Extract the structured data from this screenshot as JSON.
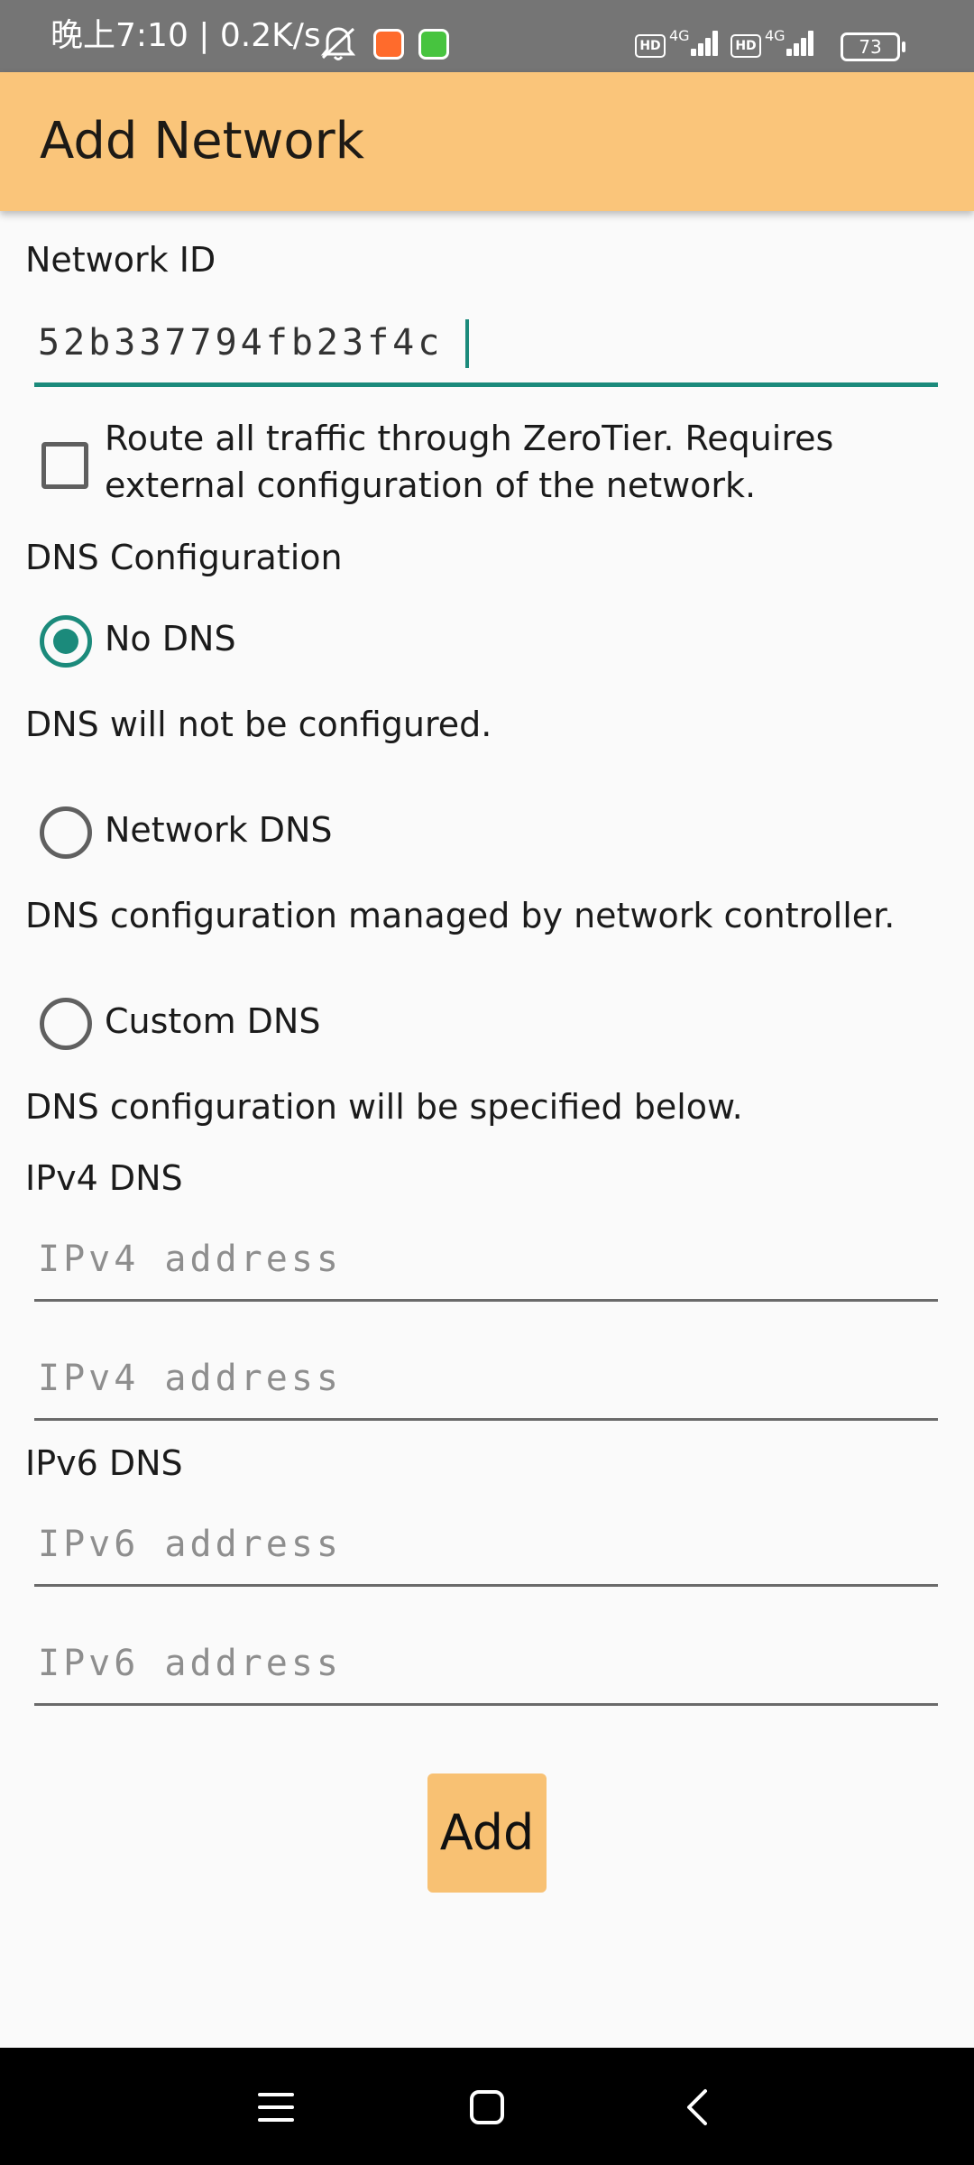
{
  "status_bar": {
    "time": "晚上7:10 | 0.2K/s",
    "badge1": "HD",
    "net1": "4G",
    "badge2": "HD",
    "net2": "4G",
    "battery": "73"
  },
  "app_bar": {
    "title": "Add Network"
  },
  "network_id": {
    "label": "Network ID",
    "value": "52b337794fb23f4c"
  },
  "route_all": {
    "label": "Route all traffic through ZeroTier. Requires external configuration of the network.",
    "checked": false
  },
  "dns": {
    "section_label": "DNS Configuration",
    "options": [
      {
        "label": "No DNS",
        "description": "DNS will not be configured.",
        "selected": true
      },
      {
        "label": "Network DNS",
        "description": "DNS configuration managed by network controller.",
        "selected": false
      },
      {
        "label": "Custom DNS",
        "description": "DNS configuration will be specified below.",
        "selected": false
      }
    ]
  },
  "ipv4": {
    "label": "IPv4 DNS",
    "placeholder_1": "IPv4 address",
    "placeholder_2": "IPv4 address"
  },
  "ipv6": {
    "label": "IPv6 DNS",
    "placeholder_1": "IPv6 address",
    "placeholder_2": "IPv6 address"
  },
  "actions": {
    "add_label": "Add"
  },
  "colors": {
    "accent": "#1b8a7b",
    "app_bar": "#fac57a",
    "button": "#f8c173"
  }
}
